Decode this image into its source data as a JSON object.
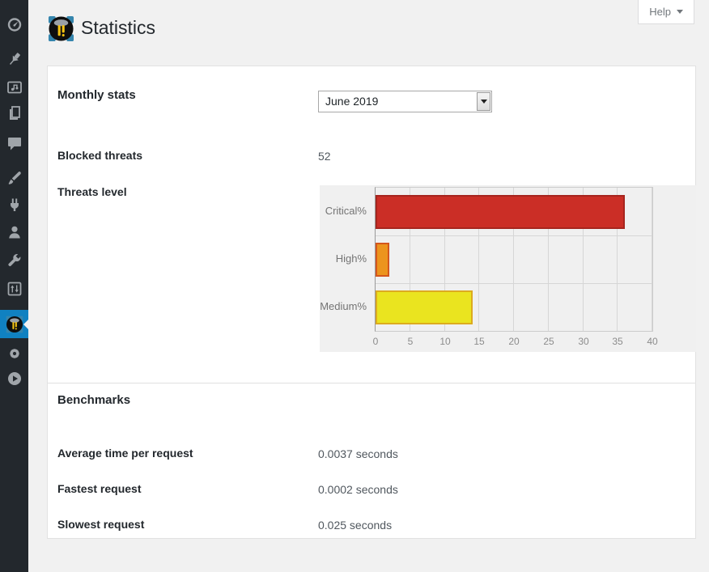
{
  "page": {
    "title": "Statistics"
  },
  "help": {
    "label": "Help"
  },
  "sidebar": {
    "items": [
      {
        "id": "dashboard",
        "icon": "dashboard-icon"
      },
      {
        "id": "posts",
        "icon": "pushpin-icon"
      },
      {
        "id": "media",
        "icon": "media-icon"
      },
      {
        "id": "pages",
        "icon": "pages-icon"
      },
      {
        "id": "comments",
        "icon": "comment-icon"
      },
      {
        "id": "appearance",
        "icon": "paintbrush-icon"
      },
      {
        "id": "plugins",
        "icon": "plug-icon"
      },
      {
        "id": "users",
        "icon": "user-icon"
      },
      {
        "id": "tools",
        "icon": "wrench-icon"
      },
      {
        "id": "settings",
        "icon": "sliders-icon"
      },
      {
        "id": "ninjafirewall",
        "icon": "ninja-logo-icon",
        "active": true
      },
      {
        "id": "extra-settings",
        "icon": "gear-icon"
      },
      {
        "id": "player",
        "icon": "play-icon"
      }
    ]
  },
  "monthly_stats": {
    "heading": "Monthly stats",
    "period_select": {
      "value": "June 2019"
    },
    "blocked_threats": {
      "label": "Blocked threats",
      "value": "52"
    },
    "threats_level": {
      "label": "Threats level"
    }
  },
  "chart_data": {
    "type": "bar",
    "orientation": "horizontal",
    "title": "Threats level",
    "categories": [
      "Critical%",
      "High%",
      "Medium%"
    ],
    "values": [
      36,
      2,
      14
    ],
    "bar_colors": [
      "#cb2e26",
      "#ec941d",
      "#eae41f"
    ],
    "bar_border_colors": [
      "#a6251e",
      "#d4561c",
      "#dcab1f"
    ],
    "xlim": [
      0,
      40
    ],
    "xticks": [
      0,
      5,
      10,
      15,
      20,
      25,
      30,
      35,
      40
    ],
    "xlabel": "",
    "ylabel": "",
    "grid": true,
    "legend": false,
    "plot_bg": "#f0f0f0"
  },
  "benchmarks": {
    "heading": "Benchmarks",
    "rows": [
      {
        "label": "Average time per request",
        "value": "0.0037 seconds"
      },
      {
        "label": "Fastest request",
        "value": "0.0002 seconds"
      },
      {
        "label": "Slowest request",
        "value": "0.025 seconds"
      }
    ]
  },
  "colors": {
    "sidebar_bg": "#23282d",
    "active_menu": "#1081c1",
    "page_bg": "#f1f1f1",
    "card_bg": "#ffffff",
    "chart_bg": "#f0f0f0",
    "heading_text": "#23282d",
    "value_text": "#50575e"
  }
}
